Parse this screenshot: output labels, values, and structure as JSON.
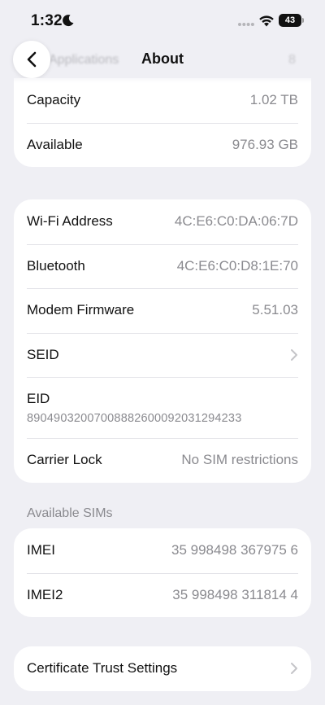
{
  "status_bar": {
    "time": "1:32",
    "battery_level": "43"
  },
  "nav": {
    "title": "About",
    "ghost_left": "Applications",
    "ghost_right": "8"
  },
  "storage": [
    {
      "label": "Capacity",
      "value": "1.02 TB"
    },
    {
      "label": "Available",
      "value": "976.93 GB"
    }
  ],
  "network": {
    "wifi_label": "Wi-Fi Address",
    "wifi_value": "4C:E6:C0:DA:06:7D",
    "bluetooth_label": "Bluetooth",
    "bluetooth_value": "4C:E6:C0:D8:1E:70",
    "modem_label": "Modem Firmware",
    "modem_value": "5.51.03",
    "seid_label": "SEID",
    "eid_label": "EID",
    "eid_value": "89049032007008882600092031294233",
    "carrier_label": "Carrier Lock",
    "carrier_value": "No SIM restrictions"
  },
  "sims": {
    "header": "Available SIMs",
    "imei_label": "IMEI",
    "imei_value": "35 998498 367975 6",
    "imei2_label": "IMEI2",
    "imei2_value": "35 998498 311814 4"
  },
  "certificate": {
    "label": "Certificate Trust Settings"
  }
}
